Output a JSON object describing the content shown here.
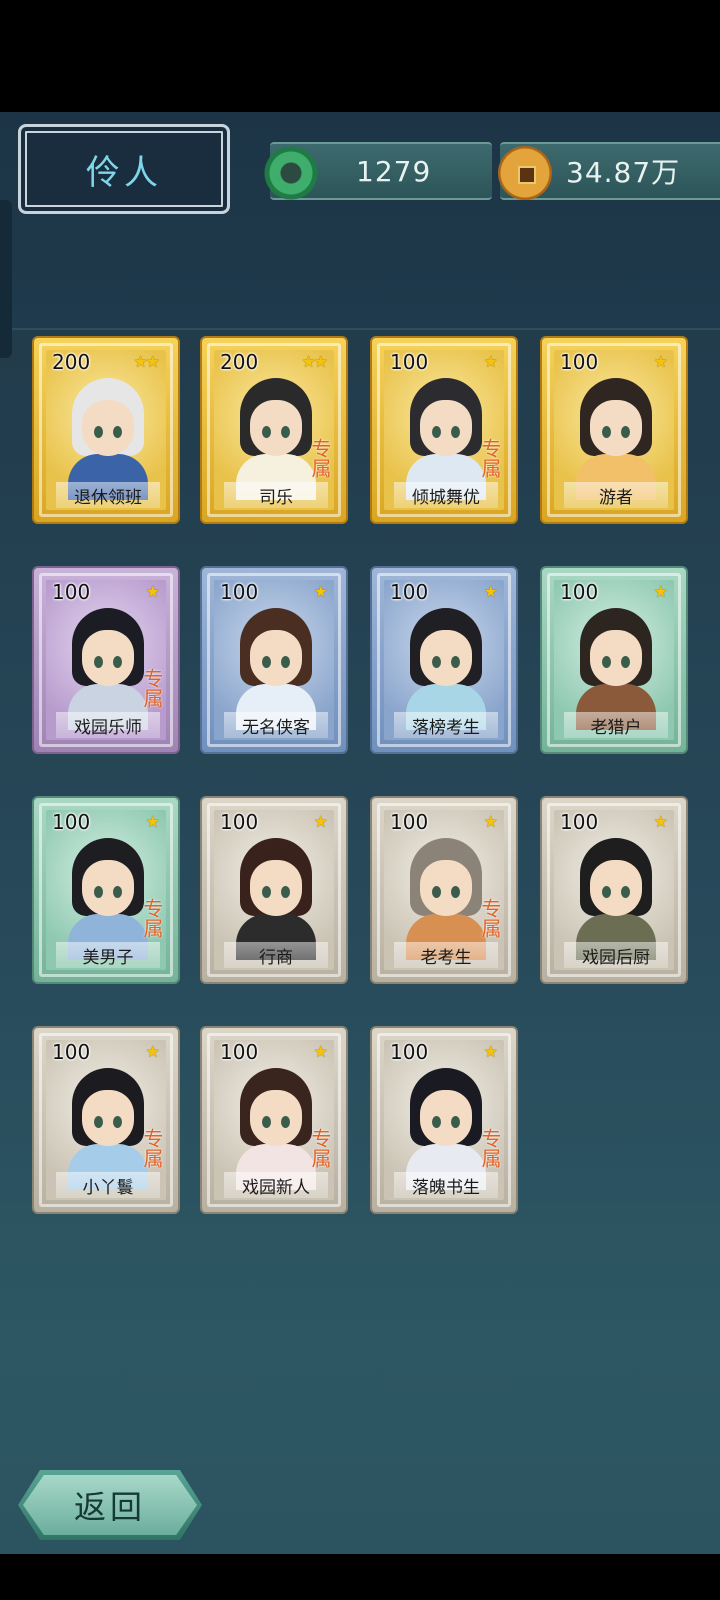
{
  "header": {
    "title": "伶人",
    "jade_value": "1279",
    "coin_value": "34.87万"
  },
  "cards": [
    {
      "cost": "200",
      "stars": 2,
      "name": "退休领班",
      "rarity": "gold",
      "tag": "",
      "hair": "#e6e6e6",
      "outfit": "#3b63a8"
    },
    {
      "cost": "200",
      "stars": 2,
      "name": "司乐",
      "rarity": "gold",
      "tag": "专属",
      "hair": "#2a2a2a",
      "outfit": "#f6f1df"
    },
    {
      "cost": "100",
      "stars": 1,
      "name": "倾城舞优",
      "rarity": "gold",
      "tag": "专属",
      "hair": "#2c2c30",
      "outfit": "#dde8f2"
    },
    {
      "cost": "100",
      "stars": 1,
      "name": "游者",
      "rarity": "gold",
      "tag": "",
      "hair": "#2f2622",
      "outfit": "#f3c06a"
    },
    {
      "cost": "100",
      "stars": 1,
      "name": "戏园乐师",
      "rarity": "purple",
      "tag": "专属",
      "hair": "#1c1c24",
      "outfit": "#c9d3e2"
    },
    {
      "cost": "100",
      "stars": 1,
      "name": "无名侠客",
      "rarity": "blue",
      "tag": "",
      "hair": "#4a2e22",
      "outfit": "#e6eef8"
    },
    {
      "cost": "100",
      "stars": 1,
      "name": "落榜考生",
      "rarity": "blue",
      "tag": "",
      "hair": "#1f1f24",
      "outfit": "#a9d6e6"
    },
    {
      "cost": "100",
      "stars": 1,
      "name": "老猎户",
      "rarity": "green",
      "tag": "",
      "hair": "#2d2520",
      "outfit": "#8a5a3a"
    },
    {
      "cost": "100",
      "stars": 1,
      "name": "美男子",
      "rarity": "green",
      "tag": "专属",
      "hair": "#1d1d22",
      "outfit": "#8fb3d9"
    },
    {
      "cost": "100",
      "stars": 1,
      "name": "行商",
      "rarity": "grey",
      "tag": "",
      "hair": "#3a221c",
      "outfit": "#2c2c2c"
    },
    {
      "cost": "100",
      "stars": 1,
      "name": "老考生",
      "rarity": "grey",
      "tag": "专属",
      "hair": "#8b8378",
      "outfit": "#d78f52"
    },
    {
      "cost": "100",
      "stars": 1,
      "name": "戏园后厨",
      "rarity": "grey",
      "tag": "",
      "hair": "#1e1e1e",
      "outfit": "#6b6e52"
    },
    {
      "cost": "100",
      "stars": 1,
      "name": "小丫鬟",
      "rarity": "grey",
      "tag": "专属",
      "hair": "#1b1b20",
      "outfit": "#a5cce8"
    },
    {
      "cost": "100",
      "stars": 1,
      "name": "戏园新人",
      "rarity": "grey",
      "tag": "专属",
      "hair": "#3a241e",
      "outfit": "#f2e4e2"
    },
    {
      "cost": "100",
      "stars": 1,
      "name": "落魄书生",
      "rarity": "grey",
      "tag": "专属",
      "hair": "#1a1a22",
      "outfit": "#e7eaf0"
    }
  ],
  "footer": {
    "back_label": "返回"
  },
  "colors": {
    "title_text": "#7fd6e8",
    "tag_text": "#e0642a",
    "star": "#f5c20c"
  }
}
